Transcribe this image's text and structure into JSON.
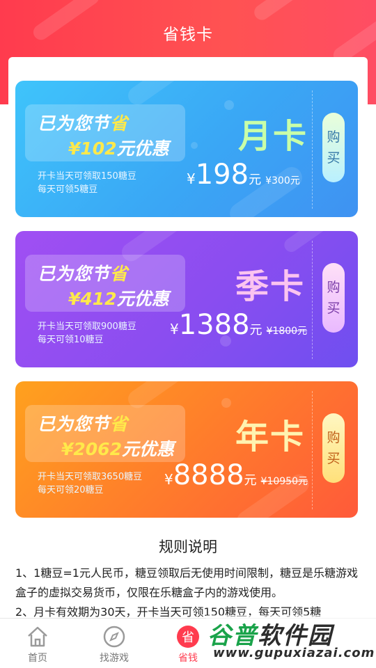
{
  "header": {
    "title": "省钱卡"
  },
  "cards": [
    {
      "save_prefix": "已为您节",
      "save_highlight": "省",
      "save_amount": "¥102",
      "save_suffix": "元优惠",
      "info1": "开卡当天可领取150糖豆",
      "info2": "每天可领5糖豆",
      "name": "月卡",
      "price_symbol": "¥",
      "price": "198",
      "price_unit": "元",
      "old_price": "¥300元",
      "buy": [
        "购",
        "买"
      ]
    },
    {
      "save_prefix": "已为您节",
      "save_highlight": "省",
      "save_amount": "¥412",
      "save_suffix": "元优惠",
      "info1": "开卡当天可领取900糖豆",
      "info2": "每天可领10糖豆",
      "name": "季卡",
      "price_symbol": "¥",
      "price": "1388",
      "price_unit": "元",
      "old_price": "¥1800元",
      "buy": [
        "购",
        "买"
      ]
    },
    {
      "save_prefix": "已为您节",
      "save_highlight": "省",
      "save_amount": "¥2062",
      "save_suffix": "元优惠",
      "info1": "开卡当天可领取3650糖豆",
      "info2": "每天可领20糖豆",
      "name": "年卡",
      "price_symbol": "¥",
      "price": "8888",
      "price_unit": "元",
      "old_price": "¥10950元",
      "buy": [
        "购",
        "买"
      ]
    }
  ],
  "rules": {
    "title": "规则说明",
    "lines": [
      "1、1糖豆=1元人民币，糖豆领取后无使用时间限制，糖豆是乐糖游戏盒子的虚拟交易货币，仅限在乐糖盒子内的游戏使用。",
      "2、月卡有效期为30天，开卡当天可领150糖豆，每天可领5糖"
    ]
  },
  "tabbar": {
    "items": [
      {
        "label": "首页",
        "icon": "home-icon"
      },
      {
        "label": "找游戏",
        "icon": "compass-icon"
      },
      {
        "label": "省钱",
        "icon": "save-money-icon",
        "icon_char": "省"
      }
    ],
    "active_color": "#ff3b4e"
  },
  "watermark": {
    "brand_g": "谷普",
    "brand_rest": "软件园",
    "url": "www.gupuxiazai.com"
  },
  "colors": {
    "header": "#ff4050",
    "blue_card": "#3aa7f5",
    "purple_card": "#8a4df0",
    "orange_card": "#ff7a2c"
  }
}
